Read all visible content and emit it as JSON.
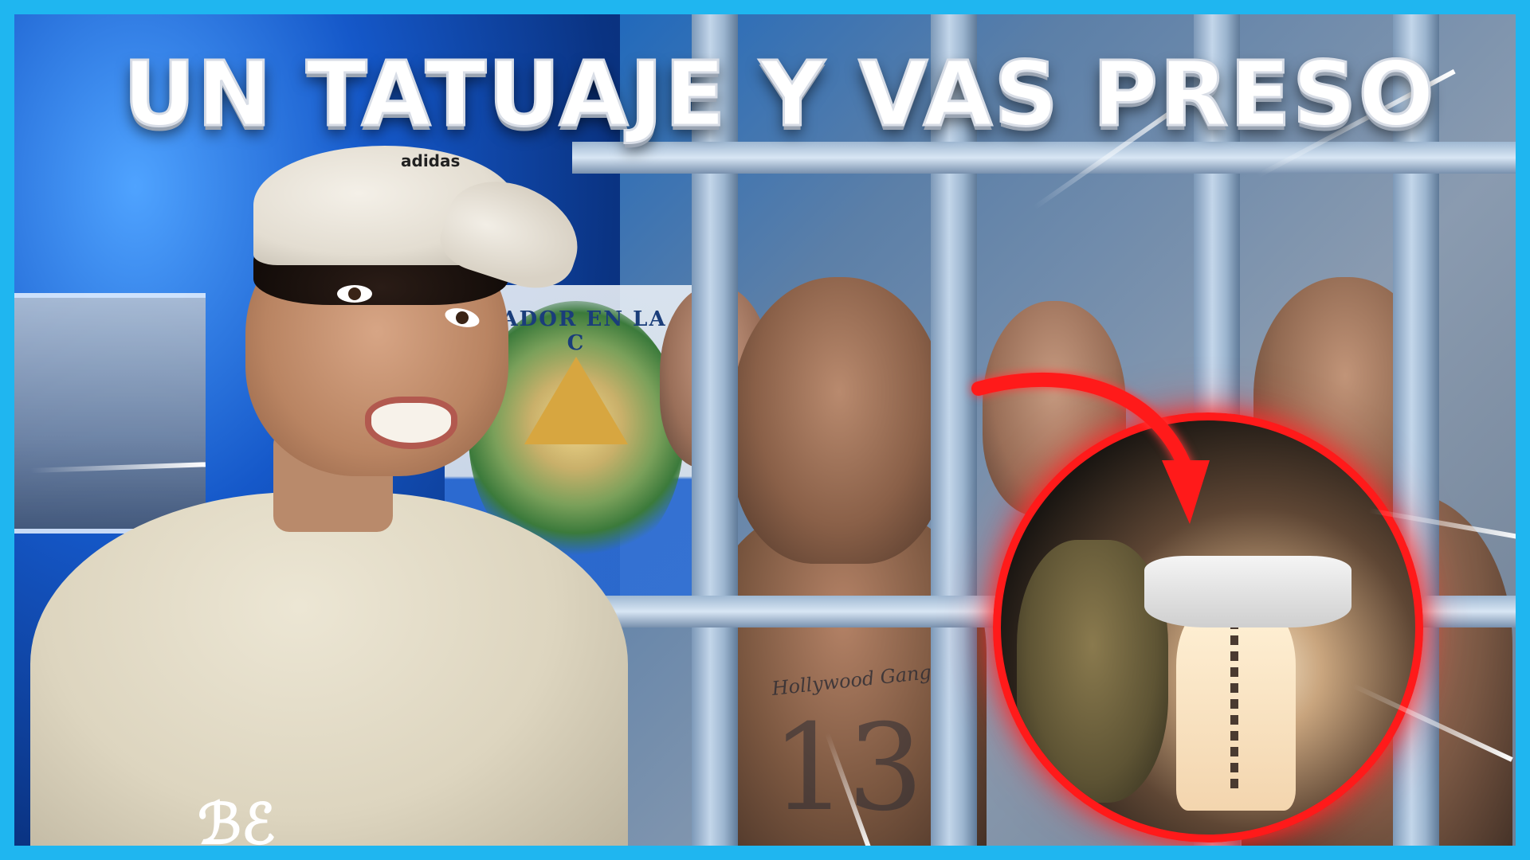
{
  "thumbnail": {
    "title": "UN TATUAJE Y VAS PRESO",
    "accent_color": "#1fb6f0",
    "highlight_circle_color": "#ff1a1a",
    "arrow_color": "#ff1a1a",
    "background_color": "#1565c0"
  },
  "coat_of_arms": {
    "text": "VADOR EN LA C"
  },
  "tattoos": {
    "neck": "Hollywood Gangster",
    "chest": "13"
  },
  "cap": {
    "logo": "adidas"
  },
  "icons": {
    "arrow": "curved-arrow-icon"
  }
}
